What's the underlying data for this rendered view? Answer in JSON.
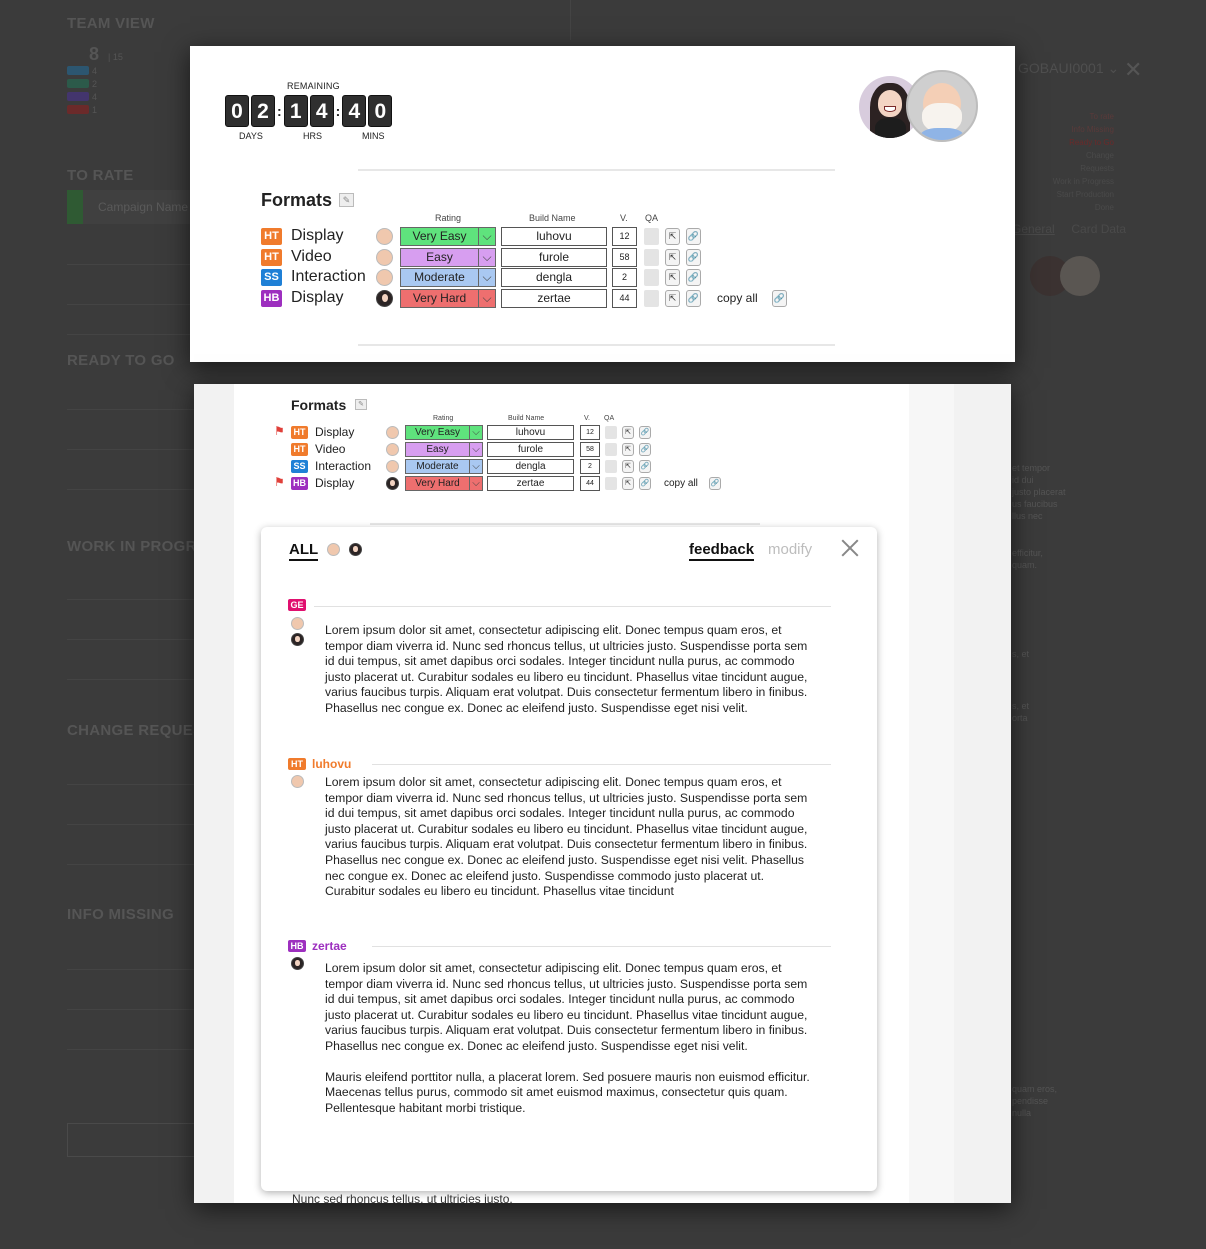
{
  "background": {
    "sections": [
      "TEAM VIEW",
      "TO RATE",
      "READY TO GO",
      "WORK IN PROGRESS",
      "CHANGE REQUESTS",
      "INFO MISSING"
    ],
    "team_count": "8",
    "team_total": "15",
    "mini_counts": [
      "4",
      "2",
      "4",
      "1"
    ],
    "campaign_name": "Campaign Name",
    "right_id": "GOBAUI0001",
    "right_status_list": [
      "To rate",
      "Info Missing",
      "Ready to Go",
      "Change Requests",
      "Work in Progress",
      "Start Production",
      "Done"
    ],
    "right_tabs": [
      "General",
      "Card Data"
    ],
    "right_snippets": [
      "et tempor",
      "id dui",
      "justo placerat",
      "us faucibus",
      "llus nec",
      "efficitur,",
      "quam.",
      "s, et",
      "s, et",
      "orta",
      "quam eros,",
      "pendisse",
      "nulla"
    ]
  },
  "top_modal": {
    "remaining_label": "REMAINING",
    "countdown": {
      "days": [
        "0",
        "2"
      ],
      "hrs": [
        "1",
        "4"
      ],
      "mins": [
        "4",
        "0"
      ]
    },
    "labels": {
      "days": "DAYS",
      "hrs": "HRS",
      "mins": "MINS"
    },
    "formats_title": "Formats",
    "column_headers": {
      "rating": "Rating",
      "build": "Build Name",
      "version": "V.",
      "qa": "QA"
    },
    "copy_all": "copy all"
  },
  "formats": [
    {
      "badge": "HT",
      "name": "Display",
      "rater": "old",
      "rating": "Very Easy",
      "rating_bg": "#5fe37d",
      "build": "luhovu",
      "version": "12",
      "flagged": true
    },
    {
      "badge": "HT",
      "name": "Video",
      "rater": "old",
      "rating": "Easy",
      "rating_bg": "#d79ef0",
      "build": "furole",
      "version": "58",
      "flagged": false
    },
    {
      "badge": "SS",
      "name": "Interaction",
      "rater": "old",
      "rating": "Moderate",
      "rating_bg": "#a9c8f1",
      "build": "dengla",
      "version": "2",
      "flagged": false
    },
    {
      "badge": "HB",
      "name": "Display",
      "rater": "girl",
      "rating": "Very Hard",
      "rating_bg": "#ee6f6f",
      "build": "zertae",
      "version": "44",
      "flagged": true
    }
  ],
  "feedback": {
    "tab_all": "ALL",
    "tab_feedback": "feedback",
    "tab_modify": "modify",
    "sections": [
      {
        "badge": "GE",
        "name": "",
        "name_color": "",
        "paragraphs": [
          "Lorem ipsum dolor sit amet, consectetur adipiscing elit. Donec tempus quam eros, et tempor diam viverra id. Nunc sed rhoncus tellus, ut ultricies justo. Suspendisse porta sem id dui tempus, sit amet dapibus orci sodales. Integer tincidunt nulla purus, ac commodo justo placerat ut. Curabitur sodales eu libero eu tincidunt. Phasellus vitae tincidunt augue, varius faucibus turpis. Aliquam erat volutpat. Duis consectetur fermentum libero in finibus. Phasellus nec congue ex. Donec ac eleifend justo. Suspendisse eget nisi velit."
        ]
      },
      {
        "badge": "HT",
        "name": "luhovu",
        "name_color": "#f07b2c",
        "paragraphs": [
          "Lorem ipsum dolor sit amet, consectetur adipiscing elit. Donec tempus quam eros, et tempor diam viverra id. Nunc sed rhoncus tellus, ut ultricies justo. Suspendisse porta sem id dui tempus, sit amet dapibus orci sodales. Integer tincidunt nulla purus, ac commodo justo placerat ut. Curabitur sodales eu libero eu tincidunt. Phasellus vitae tincidunt augue, varius faucibus turpis. Aliquam erat volutpat. Duis consectetur fermentum libero in finibus. Phasellus nec congue ex. Donec ac eleifend justo. Suspendisse eget nisi velit. Phasellus nec congue ex. Donec ac eleifend justo. Suspendisse commodo justo placerat ut. Curabitur sodales eu libero eu tincidunt. Phasellus vitae tincidunt"
        ]
      },
      {
        "badge": "HB",
        "name": "zertae",
        "name_color": "#9d2fbf",
        "paragraphs": [
          "Lorem ipsum dolor sit amet, consectetur adipiscing elit. Donec tempus quam eros, et tempor diam viverra id. Nunc sed rhoncus tellus, ut ultricies justo. Suspendisse porta sem id dui tempus, sit amet dapibus orci sodales. Integer tincidunt nulla purus, ac commodo justo placerat ut. Curabitur sodales eu libero eu tincidunt. Phasellus vitae tincidunt augue, varius faucibus turpis. Aliquam erat volutpat. Duis consectetur fermentum libero in finibus. Phasellus nec congue ex. Donec ac eleifend justo. Suspendisse eget nisi velit.",
          "Mauris eleifend porttitor nulla, a placerat lorem. Sed posuere mauris non euismod efficitur. Maecenas tellus purus, commodo sit amet euismod maximus, consectetur quis quam. Pellentesque habitant morbi tristique."
        ]
      }
    ],
    "peek_text": "Nunc sed rhoncus tellus, ut ultricies justo."
  }
}
